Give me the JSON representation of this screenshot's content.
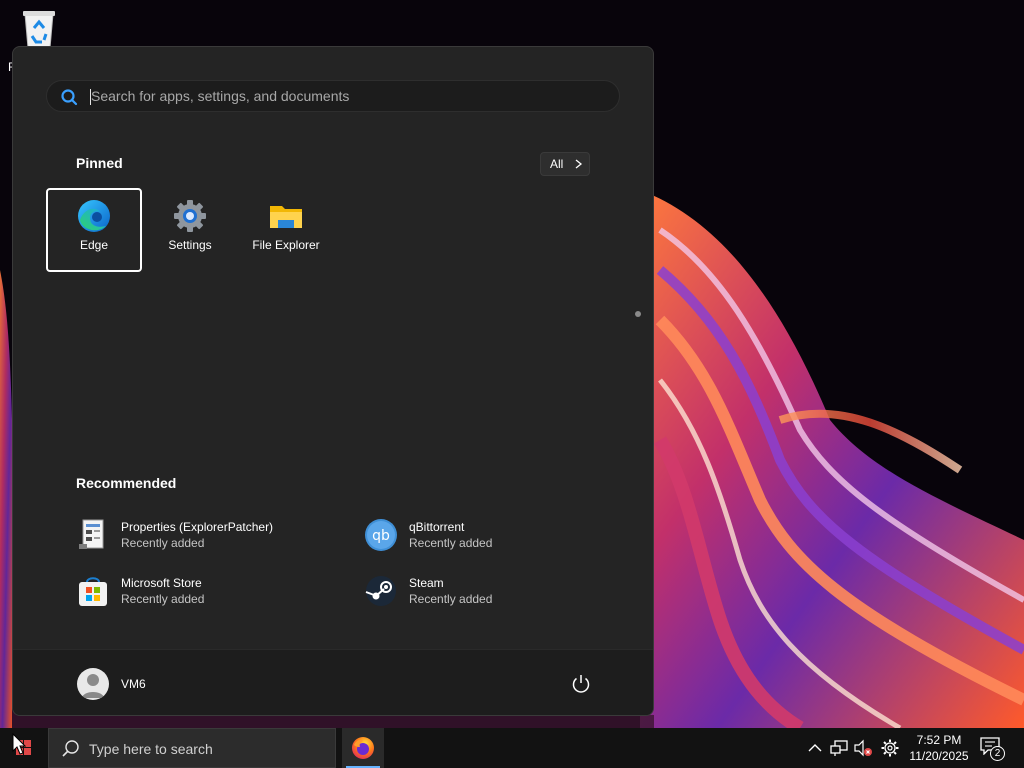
{
  "desktop": {
    "recycle_bin_label": "R"
  },
  "start_menu": {
    "search": {
      "placeholder": "Search for apps, settings, and documents",
      "value": ""
    },
    "pinned": {
      "title": "Pinned",
      "all_button_label": "All",
      "apps": [
        {
          "label": "Edge",
          "icon": "edge-icon",
          "focused": true
        },
        {
          "label": "Settings",
          "icon": "settings-gear-icon",
          "focused": false
        },
        {
          "label": "File Explorer",
          "icon": "folder-icon",
          "focused": false
        }
      ]
    },
    "recommended": {
      "title": "Recommended",
      "items": [
        {
          "name": "Properties (ExplorerPatcher)",
          "sub": "Recently added",
          "icon": "properties-icon"
        },
        {
          "name": "qBittorrent",
          "sub": "Recently added",
          "icon": "qbittorrent-icon"
        },
        {
          "name": "Microsoft Store",
          "sub": "Recently added",
          "icon": "store-icon"
        },
        {
          "name": "Steam",
          "sub": "Recently added",
          "icon": "steam-icon"
        }
      ]
    },
    "user": {
      "name": "VM6"
    }
  },
  "taskbar": {
    "search_placeholder": "Type here to search",
    "clock": {
      "time": "7:52 PM",
      "date": "11/20/2025"
    },
    "notification_count": "2",
    "accent_color": "#66b3ff"
  }
}
